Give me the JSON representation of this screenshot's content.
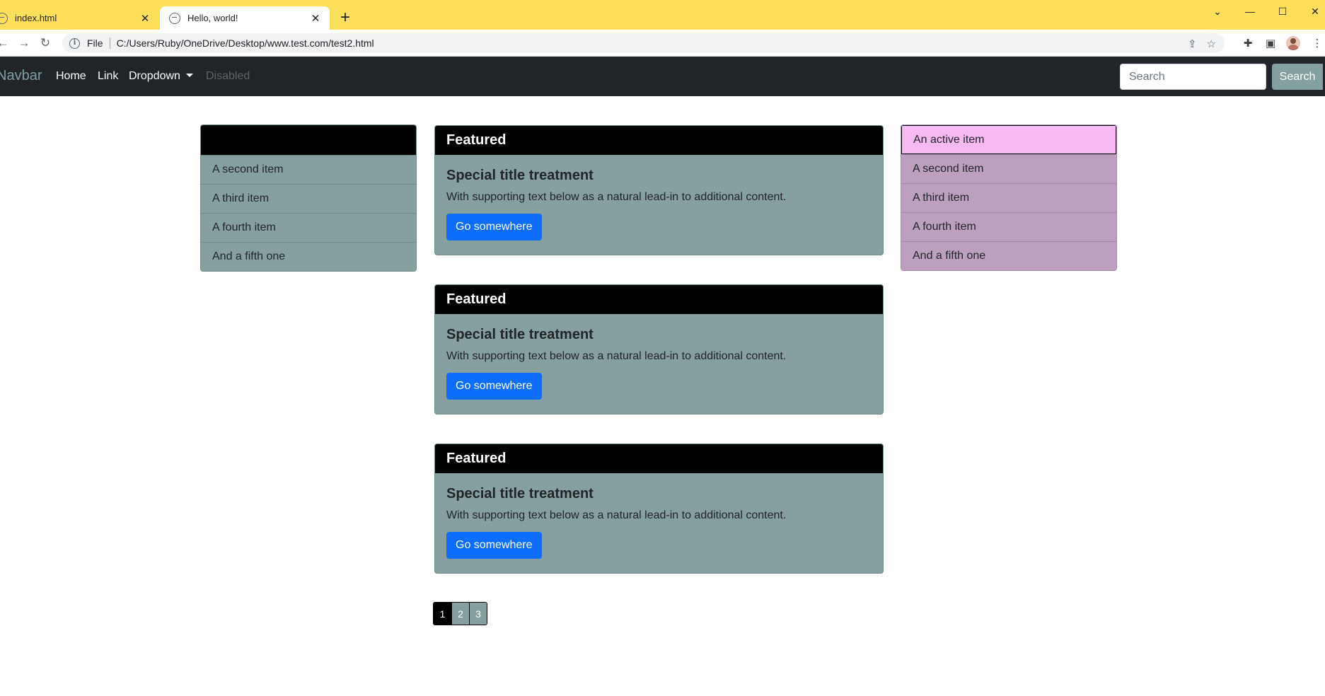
{
  "browser": {
    "tabs": [
      {
        "title": "index.html",
        "active": false
      },
      {
        "title": "Hello, world!",
        "active": true
      }
    ],
    "address": {
      "scheme": "File",
      "url": "C:/Users/Ruby/OneDrive/Desktop/www.test.com/test2.html"
    },
    "accent": "#fddf5c"
  },
  "navbar": {
    "brand": "Navbar",
    "links": {
      "home": "Home",
      "link": "Link",
      "dropdown": "Dropdown",
      "disabled": "Disabled"
    },
    "search": {
      "placeholder": "Search",
      "button": "Search"
    },
    "background": "#212529"
  },
  "left_list": {
    "items": [
      "A second item",
      "A third item",
      "A fourth item",
      "And a fifth one"
    ],
    "color": "#85a09e"
  },
  "right_list": {
    "items": [
      "An active item",
      "A second item",
      "A third item",
      "A fourth item",
      "And a fifth one"
    ],
    "active_color": "#f7b9f1",
    "color": "#bda0bf"
  },
  "cards": [
    {
      "header": "Featured",
      "title": "Special title treatment",
      "text": "With supporting text below as a natural lead-in to additional content.",
      "button": "Go somewhere"
    },
    {
      "header": "Featured",
      "title": "Special title treatment",
      "text": "With supporting text below as a natural lead-in to additional content.",
      "button": "Go somewhere"
    },
    {
      "header": "Featured",
      "title": "Special title treatment",
      "text": "With supporting text below as a natural lead-in to additional content.",
      "button": "Go somewhere"
    }
  ],
  "pagination": {
    "pages": [
      "1",
      "2",
      "3"
    ],
    "current": "1"
  }
}
